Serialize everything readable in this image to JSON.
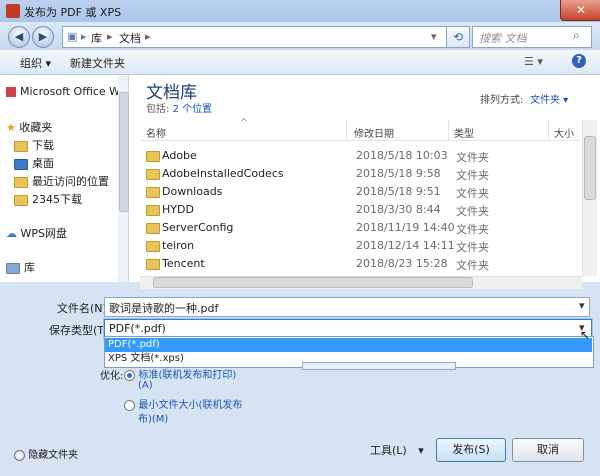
{
  "window": {
    "title": "发布为 PDF 或 XPS",
    "close_glyph": "✕"
  },
  "nav": {
    "back_glyph": "◀",
    "forward_glyph": "▶",
    "breadcrumb": [
      "库",
      "文档"
    ],
    "refresh_glyph": "⟲",
    "search_placeholder": "搜索 文档",
    "search_glyph": "⌕"
  },
  "toolbar": {
    "organize": "组织 ▾",
    "new_folder": "新建文件夹",
    "view_glyph": "☰ ▾",
    "help_glyph": "?"
  },
  "sidebar": {
    "microsoft_office": "Microsoft Office W",
    "favorites": "收藏夹",
    "items": [
      "下载",
      "桌面",
      "最近访问的位置",
      "2345下载"
    ],
    "wps": "WPS网盘",
    "library": "库"
  },
  "library": {
    "title": "文档库",
    "include_prefix": "包括: ",
    "include_link": "2 个位置",
    "sort_label": "排列方式:",
    "sort_value": "文件夹 ▾"
  },
  "columns": {
    "name": "名称",
    "modified": "修改日期",
    "type": "类型",
    "size": "大小"
  },
  "files": [
    {
      "name": "Adobe",
      "date": "2018/5/18 10:03",
      "type": "文件夹"
    },
    {
      "name": "AdobeInstalledCodecs",
      "date": "2018/5/18 9:58",
      "type": "文件夹"
    },
    {
      "name": "Downloads",
      "date": "2018/5/18 9:51",
      "type": "文件夹"
    },
    {
      "name": "HYDD",
      "date": "2018/3/30 8:44",
      "type": "文件夹"
    },
    {
      "name": "ServerConfig",
      "date": "2018/11/19 14:40",
      "type": "文件夹"
    },
    {
      "name": "teiron",
      "date": "2018/12/14 14:11",
      "type": "文件夹"
    },
    {
      "name": "Tencent",
      "date": "2018/8/23 15:28",
      "type": "文件夹"
    }
  ],
  "form": {
    "filename_label": "文件名(N):",
    "filename_value": "歌词是诗歌的一种.pdf",
    "savetype_label": "保存类型(T):",
    "savetype_value": "PDF(*.pdf)",
    "options": [
      "PDF(*.pdf)",
      "XPS 文档(*.xps)"
    ],
    "optimize_label": "优化:",
    "opt1_line1": "标准(联机发布和打印)",
    "opt1_line2": "(A)",
    "opt2_line1": "最小文件大小(联机发布",
    "opt2_line2": "布)(M)"
  },
  "footer": {
    "hide_folders": "隐藏文件夹",
    "tools": "工具(L)",
    "tools_arrow": "▾",
    "publish": "发布(S)",
    "cancel": "取消"
  }
}
